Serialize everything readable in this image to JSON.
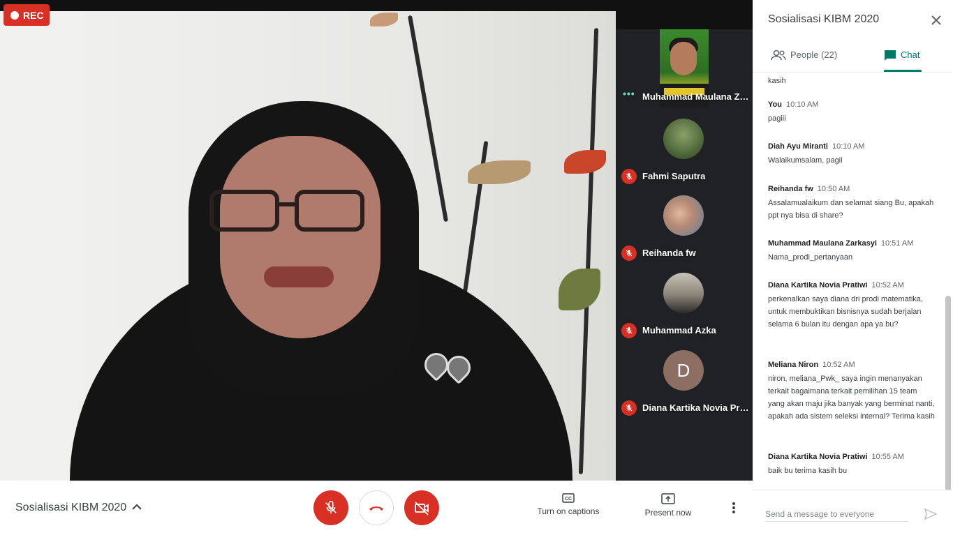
{
  "recording": {
    "label": "REC"
  },
  "meeting": {
    "title": "Sosialisasi KIBM 2020"
  },
  "participants": [
    {
      "name": "Muhammad Maulana Zarkasyi",
      "status": "speaking"
    },
    {
      "name": "Fahmi Saputra",
      "status": "muted"
    },
    {
      "name": "Reihanda fw",
      "status": "muted"
    },
    {
      "name": "Muhammad Azka",
      "status": "muted"
    },
    {
      "name": "Diana Kartika Novia Pratiwi",
      "status": "muted",
      "initial": "D"
    }
  ],
  "panel": {
    "title": "Sosialisasi KIBM 2020",
    "tabs": {
      "people": "People (22)",
      "chat": "Chat"
    },
    "partial_text": "kasih",
    "input_placeholder": "Send a message to everyone",
    "messages": [
      {
        "sender": "You",
        "time": "10:10 AM",
        "text": "pagiii"
      },
      {
        "sender": "Diah Ayu Miranti",
        "time": "10:10 AM",
        "text": "Walaikumsalam, pagii"
      },
      {
        "sender": "Reihanda fw",
        "time": "10:50 AM",
        "text": "Assalamualaikum dan selamat siang Bu, apakah ppt nya bisa di share?"
      },
      {
        "sender": "Muhammad Maulana Zarkasyi",
        "time": "10:51 AM",
        "text": "Nama_prodi_pertanyaan"
      },
      {
        "sender": "Diana Kartika Novia Pratiwi",
        "time": "10:52 AM",
        "text": "perkenalkan saya diana dri prodi matematika, untuk membuktikan bisnisnya sudah berjalan selama 6 bulan itu dengan apa ya bu?"
      },
      {
        "sender": "Meliana Niron",
        "time": "10:52 AM",
        "text": "niron, meliana_Pwk_ saya ingin menanyakan terkait bagaimana terkait pemilihan 15 team yang akan maju jika banyak yang berminat nanti, apakah ada sistem seleksi internal? Terima kasih"
      },
      {
        "sender": "Diana Kartika Novia Pratiwi",
        "time": "10:55 AM",
        "text": "baik bu terima kasih bu"
      }
    ]
  },
  "controls": {
    "captions_label": "Turn on captions",
    "present_label": "Present now"
  },
  "colors": {
    "accent": "#00796b",
    "danger": "#d93025"
  }
}
